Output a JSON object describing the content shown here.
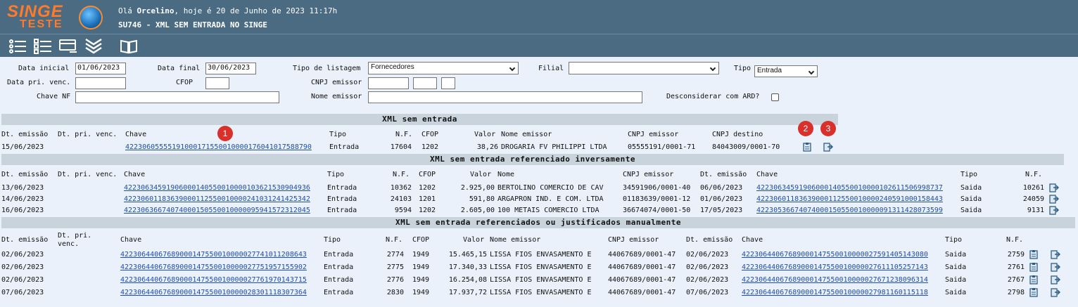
{
  "header": {
    "logo_top": "SINGE",
    "logo_bottom": "TESTE",
    "greeting_prefix": "Olá ",
    "user": "Orcelino",
    "greeting_suffix": ", hoje é 20 de Junho de 2023 11:17h",
    "title": "SU746 - XML SEM ENTRADA NO SINGE"
  },
  "toolbar": {
    "icons": [
      "list-icon",
      "checklist-icon",
      "card-icon",
      "chevrons-down-icon",
      "book-icon"
    ]
  },
  "filters": {
    "data_inicial_label": "Data inicial",
    "data_inicial": "01/06/2023",
    "data_final_label": "Data final",
    "data_final": "30/06/2023",
    "tipo_listagem_label": "Tipo de listagem",
    "tipo_listagem": "Fornecedores",
    "filial_label": "Filial",
    "filial": "",
    "tipo_label": "Tipo",
    "tipo": "Entrada",
    "data_pri_venc_label": "Data pri. venc.",
    "data_pri_venc": "",
    "cfop_label": "CFOP",
    "cfop": "",
    "cnpj_emissor_label": "CNPJ emissor",
    "chave_nf_label": "Chave NF",
    "chave_nf": "",
    "nome_emissor_label": "Nome emissor",
    "nome_emissor": "",
    "desconsiderar_label": "Desconsiderar com ARD?"
  },
  "sections": {
    "s1": {
      "title": "XML sem entrada",
      "cols": [
        "Dt. emissão",
        "Dt. pri. venc.",
        "Chave",
        "Tipo",
        "N.F.",
        "CFOP",
        "Valor",
        "Nome emissor",
        "CNPJ emissor",
        "CNPJ destino"
      ],
      "rows": [
        [
          "15/06/2023",
          "",
          "42230605555191000171550010000176041017588790",
          "Entrada",
          "17604",
          "1202",
          "38,26",
          "DROGARIA FV PHILIPPI LTDA",
          "05555191/0001-71",
          "84043009/0001-70"
        ]
      ]
    },
    "s2": {
      "title": "XML sem entrada referenciado inversamente",
      "cols": [
        "Dt. emissão",
        "Dt. pri. venc.",
        "Chave",
        "Tipo",
        "N.F.",
        "CFOP",
        "Valor",
        "Nome",
        "CNPJ emissor",
        "Dt. emissão",
        "Chave",
        "Tipo",
        "N.F."
      ],
      "rows": [
        [
          "13/06/2023",
          "",
          "42230634591906000140550010000103621530904936",
          "Entrada",
          "10362",
          "1202",
          "2.925,00",
          "BERTOLINO COMERCIO DE CAV",
          "34591906/0001-40",
          "06/06/2023",
          "42230634591906000140550010000102611506998737",
          "Saida",
          "10261"
        ],
        [
          "14/06/2023",
          "",
          "42230601183639000112550010000241031241425342",
          "Entrada",
          "24103",
          "1201",
          "591,80",
          "ARGAPRON IND. E COM. LTDA",
          "01183639/0001-12",
          "01/06/2023",
          "42230601183639000112550010000240591000158443",
          "Saida",
          "24059"
        ],
        [
          "16/06/2023",
          "",
          "42230636674074000150550010000095941572312045",
          "Entrada",
          "9594",
          "1202",
          "2.605,00",
          "100 METAIS COMERCIO LTDA",
          "36674074/0001-50",
          "17/05/2023",
          "42230536674074000150550010000091311428073599",
          "Saida",
          "9131"
        ]
      ]
    },
    "s3": {
      "title": "XML sem entrada referenciados ou justificados manualmente",
      "cols": [
        "Dt. emissão",
        "Dt. pri. venc.",
        "Chave",
        "Tipo",
        "N.F.",
        "CFOP",
        "Valor",
        "Nome emissor",
        "CNPJ emissor",
        "Dt. emissão",
        "Chave",
        "Tipo",
        "N.F."
      ],
      "rows": [
        [
          "02/06/2023",
          "",
          "42230644067689000147550010000027741011208643",
          "Entrada",
          "2774",
          "1949",
          "15.465,15",
          "LISSA FIOS ENVASAMENTO E",
          "44067689/0001-47",
          "02/06/2023",
          "42230644067689000147550010000027591405143080",
          "Saida",
          "2759"
        ],
        [
          "02/06/2023",
          "",
          "42230644067689000147550010000027751957155902",
          "Entrada",
          "2775",
          "1949",
          "17.340,33",
          "LISSA FIOS ENVASAMENTO E",
          "44067689/0001-47",
          "02/06/2023",
          "42230644067689000147550010000027611105257143",
          "Saida",
          "2761"
        ],
        [
          "02/06/2023",
          "",
          "42230644067689000147550010000027761970143715",
          "Entrada",
          "2776",
          "1949",
          "16.254,08",
          "LISSA FIOS ENVASAMENTO E",
          "44067689/0001-47",
          "02/06/2023",
          "42230644067689000147550010000027671238096314",
          "Saida",
          "2767"
        ],
        [
          "07/06/2023",
          "",
          "42230644067689000147550010000028301118307364",
          "Entrada",
          "2830",
          "1949",
          "17.937,72",
          "LISSA FIOS ENVASAMENTO E",
          "44067689/0001-47",
          "07/06/2023",
          "42230644067689000147550010000027981160115118",
          "Saida",
          "2798"
        ]
      ]
    }
  },
  "badges": [
    "1",
    "2",
    "3"
  ]
}
